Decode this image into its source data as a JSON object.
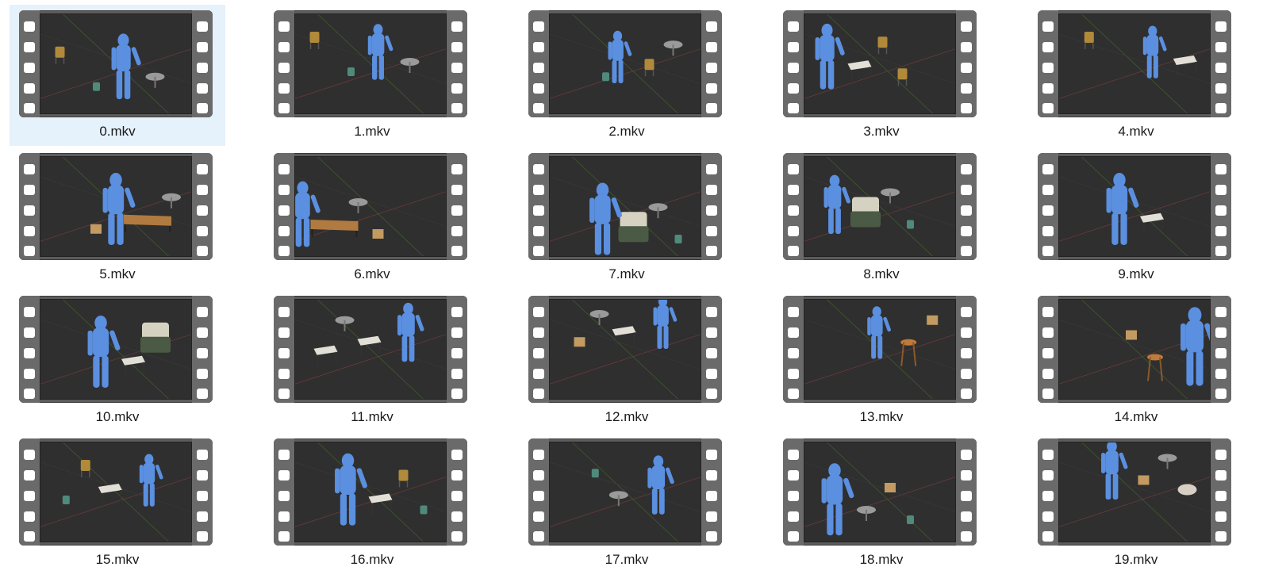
{
  "files": [
    {
      "name": "0.mkv",
      "selected": true
    },
    {
      "name": "1.mkv"
    },
    {
      "name": "2.mkv"
    },
    {
      "name": "3.mkv"
    },
    {
      "name": "4.mkv"
    },
    {
      "name": "5.mkv"
    },
    {
      "name": "6.mkv"
    },
    {
      "name": "7.mkv"
    },
    {
      "name": "8.mkv"
    },
    {
      "name": "9.mkv"
    },
    {
      "name": "10.mkv"
    },
    {
      "name": "11.mkv"
    },
    {
      "name": "12.mkv"
    },
    {
      "name": "13.mkv"
    },
    {
      "name": "14.mkv"
    },
    {
      "name": "15.mkv"
    },
    {
      "name": "16.mkv"
    },
    {
      "name": "17.mkv"
    },
    {
      "name": "18.mkv"
    },
    {
      "name": "19.mkv"
    }
  ],
  "colors": {
    "selection": "#e5f1fb",
    "figure": "#5b8fe0",
    "frame_bg": "#2f2f2f",
    "film_strip": "#6a6a6a"
  },
  "icons": {
    "thumbnail": "video-film-strip-icon"
  }
}
